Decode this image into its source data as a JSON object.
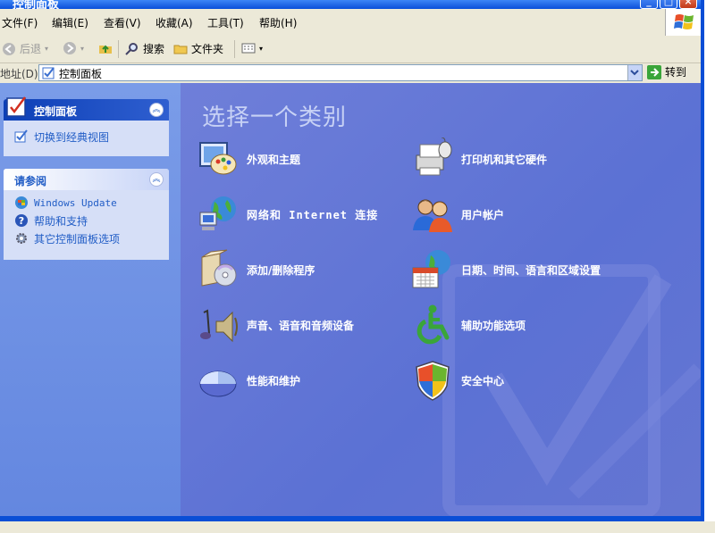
{
  "window": {
    "title": "控制面板"
  },
  "menu": [
    {
      "label": "文件(F)"
    },
    {
      "label": "编辑(E)"
    },
    {
      "label": "查看(V)"
    },
    {
      "label": "收藏(A)"
    },
    {
      "label": "工具(T)"
    },
    {
      "label": "帮助(H)"
    }
  ],
  "toolbar": {
    "back_label": "后退",
    "search_label": "搜索",
    "folders_label": "文件夹"
  },
  "address": {
    "label": "地址(D)",
    "value": "控制面板",
    "go_label": "转到"
  },
  "left_panels": {
    "control_panel": {
      "title": "控制面板",
      "switch_link": "切换到经典视图"
    },
    "see_also": {
      "title": "请参阅",
      "items": [
        {
          "label": "Windows Update"
        },
        {
          "label": "帮助和支持"
        },
        {
          "label": "其它控制面板选项"
        }
      ]
    }
  },
  "main": {
    "heading": "选择一个类别",
    "categories": [
      {
        "label": "外观和主题",
        "icon": "appearance-icon"
      },
      {
        "label": "打印机和其它硬件",
        "icon": "printer-icon"
      },
      {
        "label": "网络和 Internet 连接",
        "icon": "network-icon"
      },
      {
        "label": "用户帐户",
        "icon": "users-icon"
      },
      {
        "label": "添加/删除程序",
        "icon": "add-remove-programs-icon"
      },
      {
        "label": "日期、时间、语言和区域设置",
        "icon": "date-time-region-icon"
      },
      {
        "label": "声音、语音和音频设备",
        "icon": "sound-icon"
      },
      {
        "label": "辅助功能选项",
        "icon": "accessibility-icon"
      },
      {
        "label": "性能和维护",
        "icon": "performance-icon"
      },
      {
        "label": "安全中心",
        "icon": "security-center-icon"
      }
    ]
  },
  "colors": {
    "title_bar": "#0a4fd9",
    "left_pane": "#6f8fe4",
    "main_pane": "#5b71d4",
    "link": "#215dc6"
  }
}
